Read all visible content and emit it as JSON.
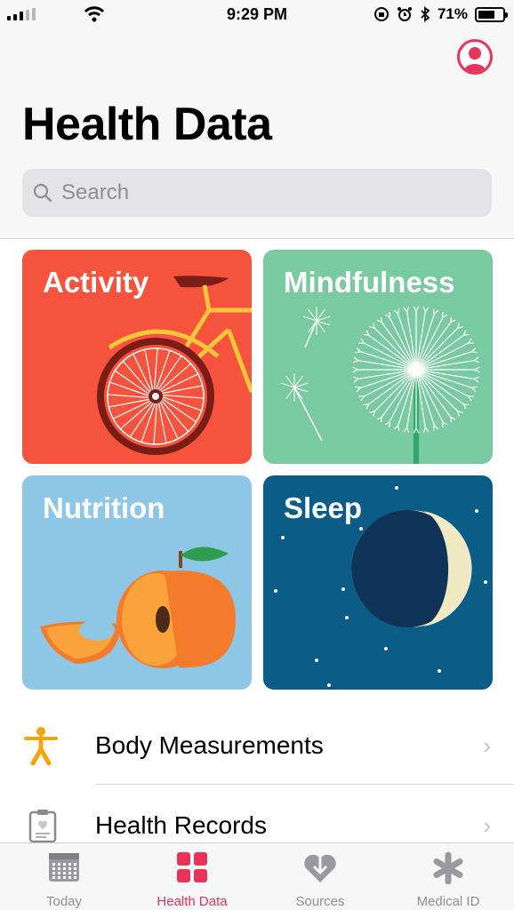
{
  "status_bar": {
    "time": "9:29 PM",
    "battery": "71%",
    "battery_level": 0.71,
    "icons": [
      "signal-icon",
      "wifi-icon",
      "orientation-lock-icon",
      "alarm-icon",
      "bluetooth-icon",
      "battery-icon"
    ]
  },
  "header": {
    "title": "Health Data",
    "profile_icon": "profile-avatar-icon"
  },
  "search": {
    "placeholder": "Search",
    "icon": "search-icon"
  },
  "tiles": [
    {
      "label": "Activity",
      "color": "#f5533d"
    },
    {
      "label": "Mindfulness",
      "color": "#79c9a1"
    },
    {
      "label": "Nutrition",
      "color": "#8ec6e6"
    },
    {
      "label": "Sleep",
      "color": "#0b5c86"
    }
  ],
  "list": [
    {
      "label": "Body Measurements",
      "icon": "person-icon"
    },
    {
      "label": "Health Records",
      "icon": "clipboard-icon"
    }
  ],
  "tab_bar": {
    "tabs": [
      {
        "label": "Today",
        "icon": "calendar-icon",
        "active": false
      },
      {
        "label": "Health Data",
        "icon": "grid-icon",
        "active": true
      },
      {
        "label": "Sources",
        "icon": "heart-download-icon",
        "active": false
      },
      {
        "label": "Medical ID",
        "icon": "asterisk-icon",
        "active": false
      }
    ]
  },
  "colors": {
    "accent": "#e8345a",
    "body_measurements_icon": "#f2a60c"
  }
}
